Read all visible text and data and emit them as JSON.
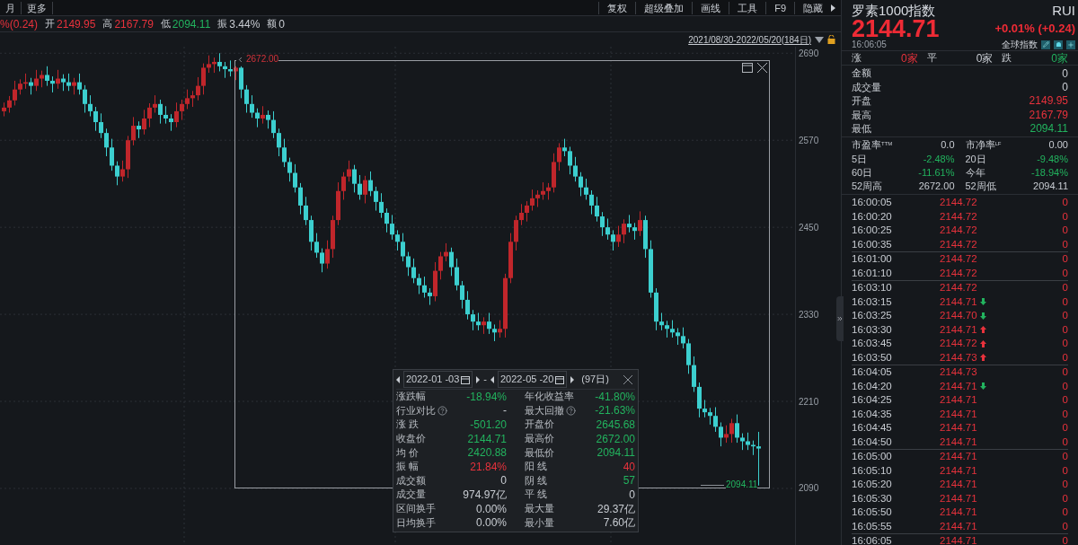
{
  "toolbar": {
    "left_items": [
      "月",
      "更多"
    ],
    "right_items": [
      "复权",
      "超级叠加",
      "画线",
      "工具",
      "F9",
      "隐藏"
    ]
  },
  "quote_bar": [
    {
      "value": "%(0.24)",
      "color": "#e8323c"
    },
    {
      "label": "开",
      "value": "2149.95",
      "color": "#e8323c"
    },
    {
      "label": "高",
      "value": "2167.79",
      "color": "#e8323c"
    },
    {
      "label": "低",
      "value": "2094.11",
      "color": "#22b35e"
    },
    {
      "label": "振",
      "value": "3.44%",
      "color": "#c8ccd2"
    },
    {
      "label": "额",
      "value": "0",
      "color": "#c8ccd2"
    }
  ],
  "date_range": "2021/08/30-2022/05/20(184日)",
  "chart": {
    "high_marker": "2672.00",
    "low_marker": "2094.11",
    "chart_data": {
      "type": "candlestick",
      "grid": true,
      "yticks": [
        2690,
        2570,
        2450,
        2330,
        2210,
        2090
      ],
      "ylim": [
        2012,
        2699
      ],
      "categories": [
        null,
        null,
        null,
        null,
        null,
        null,
        null,
        null,
        null,
        null,
        null,
        null,
        null,
        null,
        null,
        null,
        null,
        null,
        null,
        null,
        null,
        null,
        null,
        null,
        null,
        null,
        null,
        null,
        null,
        null,
        null,
        null,
        null,
        null,
        null,
        null,
        null,
        null,
        null,
        null,
        null,
        null,
        null,
        null,
        null,
        null,
        null,
        null,
        null,
        null,
        null,
        null,
        null,
        null,
        null,
        null,
        null,
        null,
        null,
        null,
        null,
        null,
        null,
        null,
        null,
        null,
        null,
        null,
        null,
        null,
        null,
        null,
        null,
        null,
        null,
        null,
        null,
        null,
        null,
        null,
        null,
        null,
        null,
        null,
        null,
        null,
        null,
        null,
        null,
        null,
        null,
        null,
        null,
        null,
        null,
        null,
        null,
        null,
        null,
        null,
        null,
        null,
        null,
        null,
        null,
        null,
        null,
        null,
        null,
        null,
        null,
        null,
        null,
        null,
        null,
        null,
        null,
        null,
        null,
        null,
        null,
        null,
        null,
        null,
        null,
        null,
        null,
        null,
        null,
        null,
        null,
        null,
        null,
        null,
        null,
        null,
        null,
        null,
        null,
        null,
        null
      ],
      "ohlc": [
        [
          2610,
          2622,
          2603,
          2615
        ],
        [
          2615,
          2631,
          2608,
          2625
        ],
        [
          2625,
          2652,
          2618,
          2640
        ],
        [
          2640,
          2654,
          2633,
          2648
        ],
        [
          2648,
          2662,
          2641,
          2650
        ],
        [
          2650,
          2656,
          2633,
          2645
        ],
        [
          2645,
          2667,
          2638,
          2655
        ],
        [
          2655,
          2666,
          2643,
          2660
        ],
        [
          2660,
          2672,
          2645,
          2652
        ],
        [
          2652,
          2658,
          2636,
          2648
        ],
        [
          2648,
          2667,
          2641,
          2655
        ],
        [
          2655,
          2661,
          2638,
          2650
        ],
        [
          2650,
          2662,
          2638,
          2645
        ],
        [
          2645,
          2656,
          2633,
          2650
        ],
        [
          2650,
          2662,
          2633,
          2640
        ],
        [
          2640,
          2646,
          2608,
          2620
        ],
        [
          2620,
          2632,
          2603,
          2610
        ],
        [
          2610,
          2616,
          2583,
          2595
        ],
        [
          2595,
          2607,
          2573,
          2580
        ],
        [
          2580,
          2586,
          2548,
          2560
        ],
        [
          2560,
          2572,
          2528,
          2535
        ],
        [
          2535,
          2541,
          2508,
          2520
        ],
        [
          2520,
          2542,
          2513,
          2530
        ],
        [
          2530,
          2576,
          2518,
          2570
        ],
        [
          2570,
          2602,
          2563,
          2590
        ],
        [
          2590,
          2596,
          2573,
          2585
        ],
        [
          2585,
          2612,
          2578,
          2600
        ],
        [
          2600,
          2621,
          2588,
          2615
        ],
        [
          2615,
          2632,
          2608,
          2620
        ],
        [
          2620,
          2626,
          2593,
          2605
        ],
        [
          2605,
          2617,
          2593,
          2600
        ],
        [
          2600,
          2606,
          2583,
          2595
        ],
        [
          2595,
          2622,
          2588,
          2610
        ],
        [
          2610,
          2626,
          2598,
          2620
        ],
        [
          2620,
          2640,
          2613,
          2628
        ],
        [
          2628,
          2638,
          2616,
          2632
        ],
        [
          2632,
          2657,
          2625,
          2645
        ],
        [
          2645,
          2676,
          2633,
          2670
        ],
        [
          2670,
          2687,
          2663,
          2675
        ],
        [
          2675,
          2684,
          2663,
          2678
        ],
        [
          2678,
          2690,
          2665,
          2672
        ],
        [
          2672,
          2678,
          2656,
          2668
        ],
        [
          2668,
          2680,
          2658,
          2665
        ],
        [
          2665,
          2672,
          2653,
          2670
        ],
        [
          2670,
          2672,
          2628,
          2640
        ],
        [
          2640,
          2646,
          2608,
          2620
        ],
        [
          2620,
          2632,
          2601,
          2608
        ],
        [
          2608,
          2614,
          2588,
          2600
        ],
        [
          2600,
          2617,
          2593,
          2605
        ],
        [
          2605,
          2611,
          2586,
          2598
        ],
        [
          2598,
          2610,
          2573,
          2580
        ],
        [
          2580,
          2586,
          2548,
          2560
        ],
        [
          2560,
          2572,
          2533,
          2540
        ],
        [
          2540,
          2546,
          2513,
          2525
        ],
        [
          2525,
          2537,
          2498,
          2505
        ],
        [
          2505,
          2511,
          2468,
          2480
        ],
        [
          2480,
          2492,
          2453,
          2460
        ],
        [
          2460,
          2466,
          2418,
          2430
        ],
        [
          2430,
          2442,
          2408,
          2415
        ],
        [
          2415,
          2421,
          2388,
          2400
        ],
        [
          2400,
          2432,
          2393,
          2420
        ],
        [
          2420,
          2466,
          2408,
          2460
        ],
        [
          2460,
          2512,
          2453,
          2500
        ],
        [
          2500,
          2526,
          2488,
          2520
        ],
        [
          2520,
          2542,
          2513,
          2530
        ],
        [
          2530,
          2536,
          2498,
          2510
        ],
        [
          2510,
          2522,
          2488,
          2495
        ],
        [
          2495,
          2521,
          2483,
          2515
        ],
        [
          2515,
          2527,
          2493,
          2500
        ],
        [
          2500,
          2506,
          2473,
          2485
        ],
        [
          2485,
          2497,
          2463,
          2470
        ],
        [
          2470,
          2476,
          2443,
          2455
        ],
        [
          2455,
          2467,
          2433,
          2440
        ],
        [
          2440,
          2446,
          2418,
          2430
        ],
        [
          2430,
          2442,
          2403,
          2410
        ],
        [
          2410,
          2416,
          2383,
          2395
        ],
        [
          2395,
          2407,
          2373,
          2380
        ],
        [
          2380,
          2386,
          2358,
          2370
        ],
        [
          2370,
          2382,
          2353,
          2360
        ],
        [
          2360,
          2366,
          2343,
          2355
        ],
        [
          2355,
          2402,
          2348,
          2390
        ],
        [
          2390,
          2416,
          2378,
          2410
        ],
        [
          2410,
          2428,
          2403,
          2416
        ],
        [
          2416,
          2422,
          2383,
          2395
        ],
        [
          2395,
          2407,
          2363,
          2370
        ],
        [
          2370,
          2376,
          2338,
          2350
        ],
        [
          2350,
          2362,
          2323,
          2330
        ],
        [
          2330,
          2336,
          2308,
          2320
        ],
        [
          2320,
          2332,
          2308,
          2315
        ],
        [
          2315,
          2326,
          2303,
          2320
        ],
        [
          2320,
          2332,
          2303,
          2310
        ],
        [
          2310,
          2316,
          2293,
          2305
        ],
        [
          2305,
          2322,
          2298,
          2310
        ],
        [
          2310,
          2386,
          2298,
          2380
        ],
        [
          2380,
          2442,
          2373,
          2430
        ],
        [
          2430,
          2466,
          2418,
          2460
        ],
        [
          2460,
          2482,
          2453,
          2470
        ],
        [
          2470,
          2486,
          2458,
          2480
        ],
        [
          2480,
          2502,
          2473,
          2490
        ],
        [
          2490,
          2501,
          2478,
          2495
        ],
        [
          2495,
          2512,
          2488,
          2500
        ],
        [
          2500,
          2511,
          2488,
          2505
        ],
        [
          2505,
          2552,
          2498,
          2540
        ],
        [
          2540,
          2566,
          2528,
          2560
        ],
        [
          2560,
          2572,
          2548,
          2555
        ],
        [
          2555,
          2561,
          2523,
          2535
        ],
        [
          2535,
          2547,
          2513,
          2520
        ],
        [
          2520,
          2526,
          2493,
          2505
        ],
        [
          2505,
          2517,
          2488,
          2495
        ],
        [
          2495,
          2501,
          2468,
          2480
        ],
        [
          2480,
          2492,
          2458,
          2465
        ],
        [
          2465,
          2471,
          2438,
          2450
        ],
        [
          2450,
          2462,
          2433,
          2440
        ],
        [
          2440,
          2446,
          2418,
          2430
        ],
        [
          2430,
          2452,
          2423,
          2440
        ],
        [
          2440,
          2461,
          2428,
          2455
        ],
        [
          2455,
          2467,
          2443,
          2450
        ],
        [
          2450,
          2456,
          2433,
          2445
        ],
        [
          2445,
          2472,
          2438,
          2460
        ],
        [
          2460,
          2466,
          2408,
          2420
        ],
        [
          2420,
          2432,
          2353,
          2360
        ],
        [
          2360,
          2366,
          2308,
          2320
        ],
        [
          2320,
          2332,
          2308,
          2315
        ],
        [
          2315,
          2321,
          2298,
          2310
        ],
        [
          2310,
          2322,
          2298,
          2305
        ],
        [
          2305,
          2311,
          2288,
          2300
        ],
        [
          2300,
          2312,
          2283,
          2290
        ],
        [
          2290,
          2296,
          2248,
          2260
        ],
        [
          2260,
          2272,
          2223,
          2230
        ],
        [
          2230,
          2236,
          2188,
          2200
        ],
        [
          2200,
          2212,
          2188,
          2195
        ],
        [
          2195,
          2201,
          2178,
          2190
        ],
        [
          2190,
          2202,
          2168,
          2175
        ],
        [
          2175,
          2181,
          2148,
          2160
        ],
        [
          2160,
          2177,
          2153,
          2165
        ],
        [
          2165,
          2186,
          2153,
          2180
        ],
        [
          2180,
          2192,
          2153,
          2160
        ],
        [
          2160,
          2166,
          2143,
          2155
        ],
        [
          2155,
          2167,
          2143,
          2150
        ],
        [
          2150,
          2156,
          2136,
          2148
        ],
        [
          2148,
          2168,
          2094,
          2145
        ]
      ]
    }
  },
  "stats_popup": {
    "start_date": "2022-01 -03",
    "end_date": "2022-05 -20",
    "days": "(97日)",
    "separator": "-",
    "rows": [
      {
        "left": {
          "label": "涨跌幅",
          "value": "-18.94%",
          "color": "#22b35e",
          "help": false
        },
        "right": {
          "label": "年化收益率",
          "value": "-41.80%",
          "color": "#22b35e",
          "help": false
        }
      },
      {
        "left": {
          "label": "行业对比",
          "value": "-",
          "help": true
        },
        "right": {
          "label": "最大回撤",
          "value": "-21.63%",
          "color": "#22b35e",
          "help": true
        }
      },
      {
        "left": {
          "label": "涨 跌",
          "value": "-501.20",
          "color": "#22b35e",
          "help": false
        },
        "right": {
          "label": "开盘价",
          "value": "2645.68",
          "color": "#22b35e",
          "help": false
        }
      },
      {
        "left": {
          "label": "收盘价",
          "value": "2144.71",
          "color": "#22b35e",
          "help": false
        },
        "right": {
          "label": "最高价",
          "value": "2672.00",
          "color": "#22b35e",
          "help": false
        }
      },
      {
        "left": {
          "label": "均 价",
          "value": "2420.88",
          "color": "#22b35e",
          "help": false
        },
        "right": {
          "label": "最低价",
          "value": "2094.11",
          "color": "#22b35e",
          "help": false
        }
      },
      {
        "left": {
          "label": "振 幅",
          "value": "21.84%",
          "color": "#e8323c",
          "help": false
        },
        "right": {
          "label": "阳 线",
          "value": "40",
          "color": "#e8323c",
          "help": false
        }
      },
      {
        "left": {
          "label": "成交额",
          "value": "0",
          "color": "#c8ccd2",
          "help": false
        },
        "right": {
          "label": "阴 线",
          "value": "57",
          "color": "#22b35e",
          "help": false
        }
      },
      {
        "left": {
          "label": "成交量",
          "value": "974.97亿",
          "color": "#c8ccd2",
          "help": false
        },
        "right": {
          "label": "平 线",
          "value": "0",
          "color": "#c8ccd2",
          "help": false
        }
      },
      {
        "left": {
          "label": "区间换手",
          "value": "0.00%",
          "color": "#c8ccd2",
          "help": false
        },
        "right": {
          "label": "最大量",
          "value": "29.37亿",
          "color": "#c8ccd2",
          "help": false
        }
      },
      {
        "left": {
          "label": "日均换手",
          "value": "0.00%",
          "color": "#c8ccd2",
          "help": false
        },
        "right": {
          "label": "最小量",
          "value": "7.60亿",
          "color": "#c8ccd2",
          "help": false
        }
      }
    ]
  },
  "quote_panel": {
    "name": "罗素1000指数",
    "code": "RUI",
    "price": "2144.71",
    "change": "+0.01% (+0.24)",
    "time": "16:06:05",
    "link": "全球指数",
    "breadth": [
      {
        "label": "涨",
        "value": "0家",
        "color": "#e8323c"
      },
      {
        "label": "平",
        "value": "0家",
        "color": "#c8ccd2"
      },
      {
        "label": "跌",
        "value": "0家",
        "color": "#22b35e"
      }
    ],
    "quote_rows": [
      {
        "label": "金额",
        "value": "0",
        "color": "#c8ccd2"
      },
      {
        "label": "成交量",
        "value": "0",
        "color": "#c8ccd2"
      },
      {
        "label": "开盘",
        "value": "2149.95",
        "color": "#e8323c"
      },
      {
        "label": "最高",
        "value": "2167.79",
        "color": "#e8323c"
      },
      {
        "label": "最低",
        "value": "2094.11",
        "color": "#22b35e"
      }
    ],
    "metrics": [
      {
        "left": {
          "label": "市盈率$^{TTM}$",
          "value": "0.0",
          "color": "#c8ccd2"
        },
        "right": {
          "label": "市净率$^{LF}$",
          "value": "0.00",
          "color": "#c8ccd2"
        }
      },
      {
        "left": {
          "label": "5日",
          "value": "-2.48%",
          "color": "#22b35e"
        },
        "right": {
          "label": "20日",
          "value": "-9.48%",
          "color": "#22b35e"
        }
      },
      {
        "left": {
          "label": "60日",
          "value": "-11.61%",
          "color": "#22b35e"
        },
        "right": {
          "label": "今年",
          "value": "-18.94%",
          "color": "#22b35e"
        }
      },
      {
        "left": {
          "label": "52周高",
          "value": "2672.00",
          "color": "#c8ccd2"
        },
        "right": {
          "label": "52周低",
          "value": "2094.11",
          "color": "#c8ccd2"
        }
      }
    ]
  },
  "ticks": [
    [
      {
        "time": "16:00:05",
        "price": "2144.72",
        "kind": "plain",
        "volume": "0"
      },
      {
        "time": "16:00:20",
        "price": "2144.72",
        "kind": "plain",
        "volume": "0"
      },
      {
        "time": "16:00:25",
        "price": "2144.72",
        "kind": "plain",
        "volume": "0"
      },
      {
        "time": "16:00:35",
        "price": "2144.72",
        "kind": "plain",
        "volume": "0"
      }
    ],
    [
      {
        "time": "16:01:00",
        "price": "2144.72",
        "kind": "plain",
        "volume": "0"
      },
      {
        "time": "16:01:10",
        "price": "2144.72",
        "kind": "plain",
        "volume": "0"
      }
    ],
    [
      {
        "time": "16:03:10",
        "price": "2144.72",
        "kind": "plain",
        "volume": "0"
      },
      {
        "time": "16:03:15",
        "price": "2144.71",
        "kind": "down",
        "volume": "0"
      },
      {
        "time": "16:03:25",
        "price": "2144.70",
        "kind": "down",
        "volume": "0"
      },
      {
        "time": "16:03:30",
        "price": "2144.71",
        "kind": "up",
        "volume": "0"
      },
      {
        "time": "16:03:45",
        "price": "2144.72",
        "kind": "up",
        "volume": "0"
      },
      {
        "time": "16:03:50",
        "price": "2144.73",
        "kind": "up",
        "volume": "0"
      }
    ],
    [
      {
        "time": "16:04:05",
        "price": "2144.73",
        "kind": "plain",
        "volume": "0"
      },
      {
        "time": "16:04:20",
        "price": "2144.71",
        "kind": "down",
        "volume": "0"
      },
      {
        "time": "16:04:25",
        "price": "2144.71",
        "kind": "plain",
        "volume": "0"
      },
      {
        "time": "16:04:35",
        "price": "2144.71",
        "kind": "plain",
        "volume": "0"
      },
      {
        "time": "16:04:45",
        "price": "2144.71",
        "kind": "plain",
        "volume": "0"
      },
      {
        "time": "16:04:50",
        "price": "2144.71",
        "kind": "plain",
        "volume": "0"
      }
    ],
    [
      {
        "time": "16:05:00",
        "price": "2144.71",
        "kind": "plain",
        "volume": "0"
      },
      {
        "time": "16:05:10",
        "price": "2144.71",
        "kind": "plain",
        "volume": "0"
      },
      {
        "time": "16:05:20",
        "price": "2144.71",
        "kind": "plain",
        "volume": "0"
      },
      {
        "time": "16:05:30",
        "price": "2144.71",
        "kind": "plain",
        "volume": "0"
      },
      {
        "time": "16:05:50",
        "price": "2144.71",
        "kind": "plain",
        "volume": "0"
      },
      {
        "time": "16:05:55",
        "price": "2144.71",
        "kind": "plain",
        "volume": "0"
      }
    ],
    [
      {
        "time": "16:06:05",
        "price": "2144.71",
        "kind": "plain",
        "volume": "0"
      }
    ]
  ]
}
